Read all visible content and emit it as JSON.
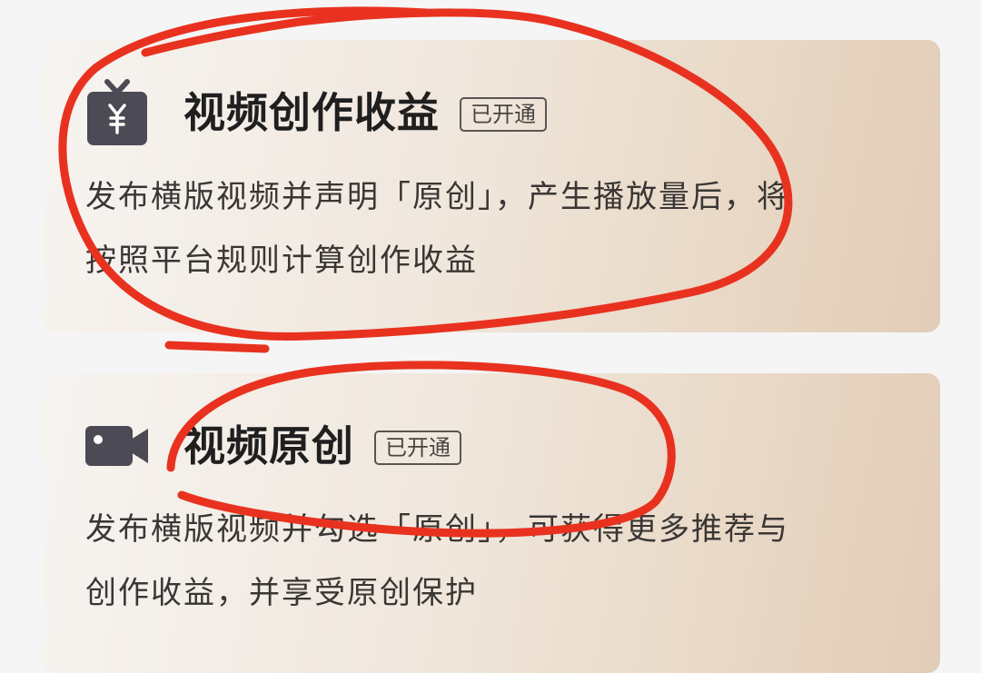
{
  "cards": [
    {
      "icon": "tv-yuan-icon",
      "title": "视频创作收益",
      "badge": "已开通",
      "desc_line1": "发布横版视频并声明「原创」，产生播放量后，将",
      "desc_line2": "按照平台规则计算创作收益"
    },
    {
      "icon": "video-camera-icon",
      "title": "视频原创",
      "badge": "已开通",
      "desc_line1": "发布横版视频并勾选「原创」，可获得更多推荐与",
      "desc_line2": "创作收益，并享受原创保护"
    }
  ],
  "colors": {
    "page_background": "#f5f5f6",
    "icon_dark": "#4b4a55",
    "annotation_red": "#e8321f"
  }
}
